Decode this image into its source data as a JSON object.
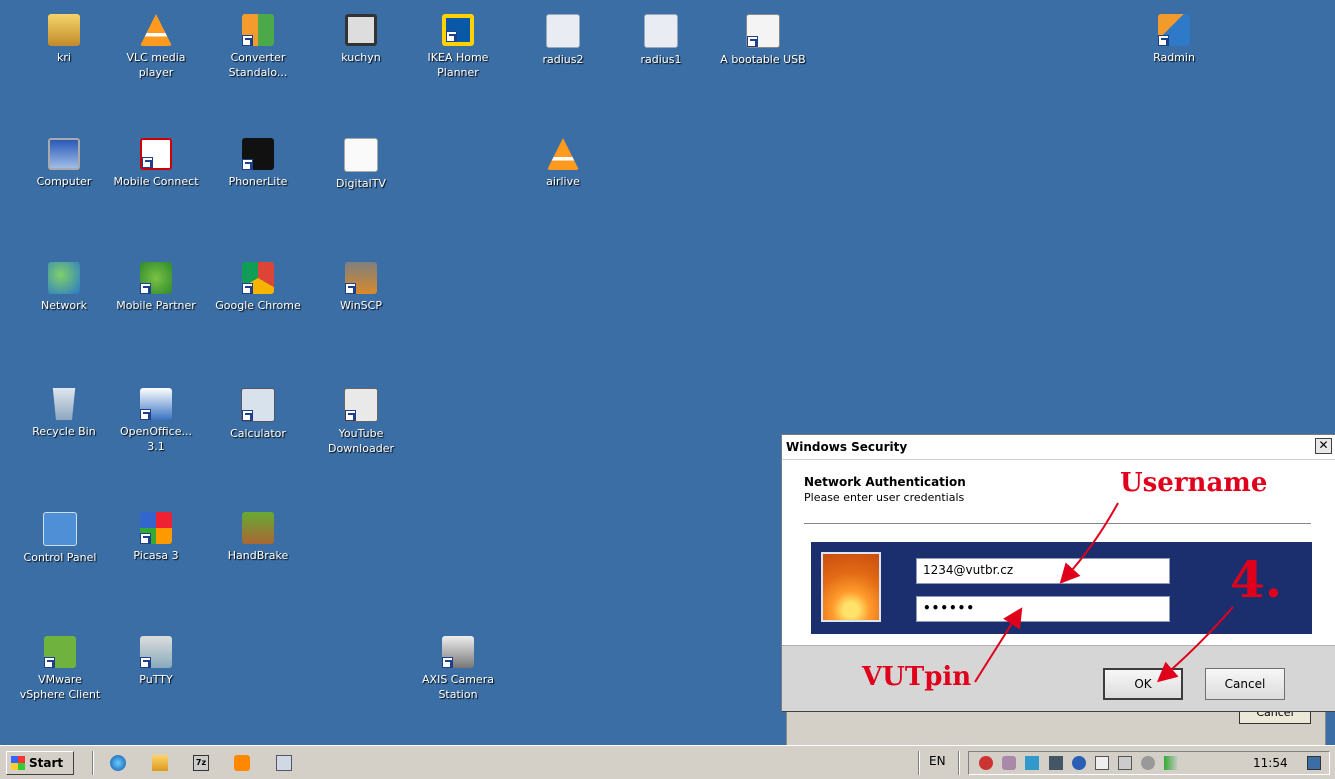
{
  "desktop": {
    "icons": [
      {
        "label": "kri",
        "icon": "user-folder-icon"
      },
      {
        "label": "VLC media\nplayer",
        "icon": "vlc-icon"
      },
      {
        "label": "Converter\nStandalo...",
        "icon": "converter-icon"
      },
      {
        "label": "kuchyn",
        "icon": "film-icon"
      },
      {
        "label": "IKEA Home\nPlanner",
        "icon": "ikea-icon"
      },
      {
        "label": "radius2",
        "icon": "certificate-icon"
      },
      {
        "label": "radius1",
        "icon": "certificate-icon"
      },
      {
        "label": "A bootable USB",
        "icon": "document-icon"
      },
      {
        "label": "Radmin",
        "icon": "radmin-icon"
      },
      {
        "label": "Computer",
        "icon": "computer-icon"
      },
      {
        "label": "Mobile Connect",
        "icon": "mobile-connect-icon"
      },
      {
        "label": "PhonerLite",
        "icon": "phone-icon"
      },
      {
        "label": "DigitalTV",
        "icon": "document-icon"
      },
      {
        "label": "airlive",
        "icon": "vlc-icon"
      },
      {
        "label": "Network",
        "icon": "network-icon"
      },
      {
        "label": "Mobile Partner",
        "icon": "mobile-partner-icon"
      },
      {
        "label": "Google Chrome",
        "icon": "chrome-icon"
      },
      {
        "label": "WinSCP",
        "icon": "winscp-icon"
      },
      {
        "label": "Recycle Bin",
        "icon": "recycle-bin-icon"
      },
      {
        "label": "OpenOffice...\n3.1",
        "icon": "openoffice-icon"
      },
      {
        "label": "Calculator",
        "icon": "calculator-icon"
      },
      {
        "label": "YouTube\nDownloader",
        "icon": "download-icon"
      },
      {
        "label": "Control Panel",
        "icon": "control-panel-icon"
      },
      {
        "label": "Picasa 3",
        "icon": "picasa-icon"
      },
      {
        "label": "HandBrake",
        "icon": "handbrake-icon"
      },
      {
        "label": "VMware\nvSphere Client",
        "icon": "vmware-icon"
      },
      {
        "label": "PuTTY",
        "icon": "putty-icon"
      },
      {
        "label": "AXIS Camera\nStation",
        "icon": "camera-icon"
      }
    ]
  },
  "dialog": {
    "title": "Windows Security",
    "close_glyph": "✕",
    "heading": "Network Authentication",
    "subheading": "Please enter user credentials",
    "username_value": "1234@vutbr.cz",
    "password_mask": "••••••",
    "ok_label": "OK",
    "cancel_label": "Cancel"
  },
  "background_window": {
    "cancel_label": "Cancel"
  },
  "annotations": {
    "username": "Username",
    "vutpin": "VUTpin",
    "step": "4.",
    "color": "#e0001c"
  },
  "taskbar": {
    "start_label": "Start",
    "quick_launch": [
      "ie-icon",
      "folder-icon",
      "7zip-icon",
      "media-player-icon",
      "calculator-icon"
    ],
    "quick_7z_text": "7z",
    "language": "EN",
    "clock": "11:54"
  },
  "colors": {
    "desktop": "#3a6ea5",
    "credential_panel": "#1b2f6e"
  }
}
